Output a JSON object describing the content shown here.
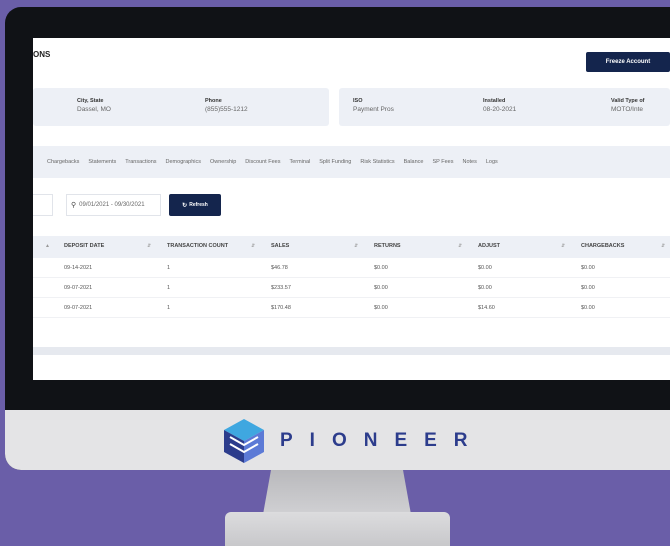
{
  "header": {
    "title": "ONS",
    "freeze_label": "Freeze Account"
  },
  "info": {
    "city_label": "City, State",
    "city_value": "Dassel, MO",
    "phone_label": "Phone",
    "phone_value": "(855)555-1212",
    "iso_label": "ISO",
    "iso_value": "Payment Pros",
    "installed_label": "Installed",
    "installed_value": "08-20-2021",
    "valid_label": "Valid Type of",
    "valid_value": "MOTO/Inte"
  },
  "tabs": [
    "Chargebacks",
    "Statements",
    "Transactions",
    "Demographics",
    "Ownership",
    "Discount Fees",
    "Terminal",
    "Split Funding",
    "Risk Statistics",
    "Balance",
    "SP Fees",
    "Notes",
    "Logs"
  ],
  "filter": {
    "date_range": "09/01/2021 - 09/30/2021",
    "refresh_label": "Refresh"
  },
  "table": {
    "headers": [
      "DEPOSIT DATE",
      "TRANSACTION COUNT",
      "SALES",
      "RETURNS",
      "ADJUST",
      "CHARGEBACKS"
    ],
    "rows": [
      [
        "09-14-2021",
        "1",
        "$46.78",
        "$0.00",
        "$0.00",
        "$0.00"
      ],
      [
        "09-07-2021",
        "1",
        "$233.57",
        "$0.00",
        "$0.00",
        "$0.00"
      ],
      [
        "09-07-2021",
        "1",
        "$170.48",
        "$0.00",
        "$14.60",
        "$0.00"
      ]
    ]
  },
  "brand": {
    "name": "PIONEER",
    "color": "#2c3c8c"
  }
}
